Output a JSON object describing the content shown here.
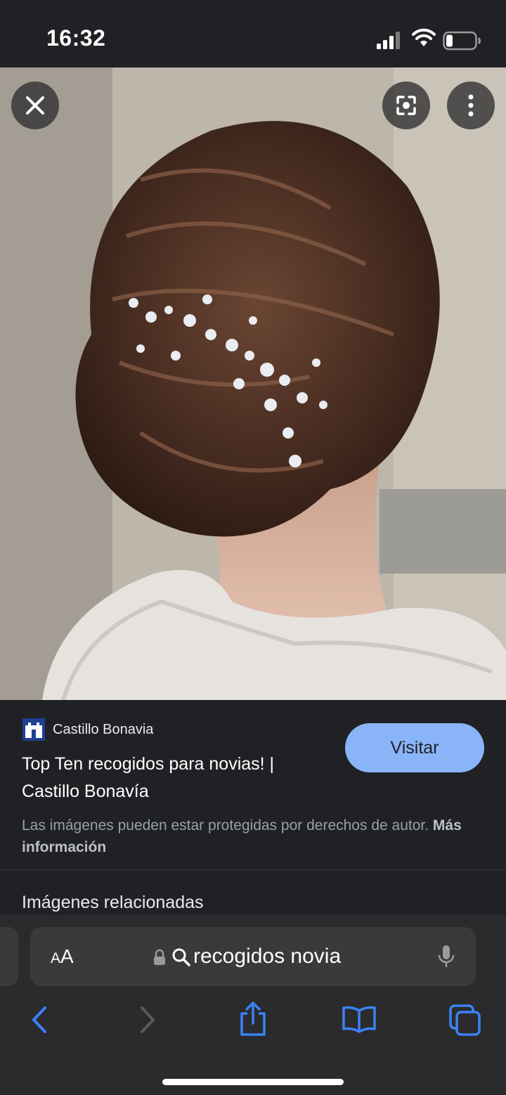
{
  "status_bar": {
    "time": "16:32"
  },
  "overlay": {
    "close_icon": "close-icon",
    "lens_icon": "google-lens-icon",
    "more_icon": "more-vertical-icon"
  },
  "result": {
    "source_name": "Castillo Bonavia",
    "title": "Top Ten recogidos para novias! | Castillo Bonavía",
    "visit_label": "Visitar",
    "copyright_text": "Las imágenes pueden estar protegidas por derechos de autor.",
    "more_info_link": "Más información"
  },
  "related": {
    "heading": "Imágenes relacionadas"
  },
  "browser": {
    "aa_large": "A",
    "aa_small": "A",
    "query": "recogidos novia"
  },
  "colors": {
    "accent": "#8ab4f8",
    "background": "#202124",
    "toolbar": "#2b2b2d",
    "ios_blue": "#3b82f6"
  }
}
